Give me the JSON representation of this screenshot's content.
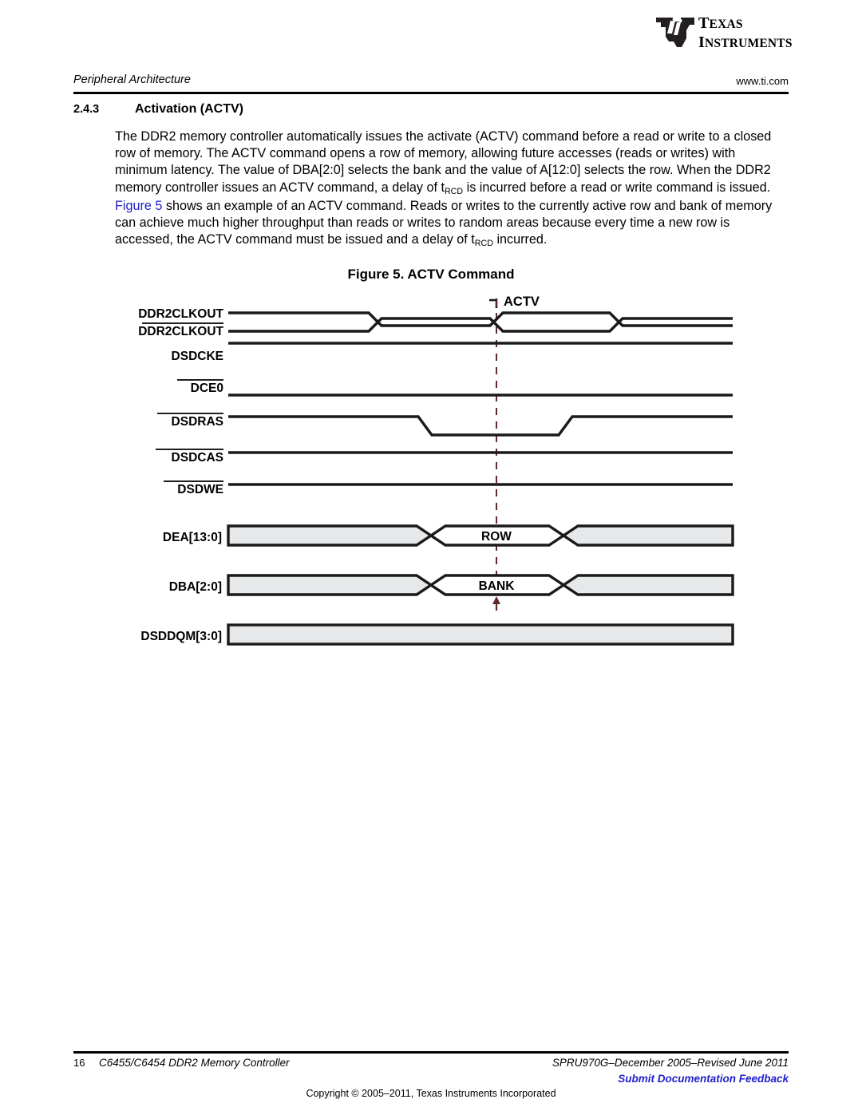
{
  "brand": {
    "logo_icon": "ti-logo-icon",
    "line1": "TEXAS",
    "line2": "INSTRUMENTS"
  },
  "header": {
    "title": "Peripheral Architecture",
    "url": "www.ti.com"
  },
  "section": {
    "number": "2.4.3",
    "title": "Activation (ACTV)"
  },
  "body": {
    "paragraph_part1": "The DDR2 memory controller automatically issues the activate (ACTV) command before a read or write to a closed row of memory. The ACTV command opens a row of memory, allowing future accesses (reads or writes) with minimum latency. The value of DBA[2:0] selects the bank and the value of A[12:0] selects the row. When the DDR2 memory controller issues an ACTV command, a delay of t",
    "sub1": "RCD",
    "paragraph_part2": " is incurred before a read or write command is issued. ",
    "link_text": "Figure 5",
    "paragraph_part3": " shows an example of an ACTV command. Reads or writes to the currently active row and bank of memory can achieve much higher throughput than reads or writes to random areas because every time a new row is accessed, the ACTV command must be issued and a delay of t",
    "sub2": "RCD",
    "paragraph_part4": " incurred."
  },
  "figure": {
    "caption": "Figure 5. ACTV Command",
    "marker_label": "ACTV",
    "signals": [
      {
        "name": "DDR2CLKOUT",
        "overbar": false,
        "type": "clock"
      },
      {
        "name": "DDR2CLKOUT",
        "overbar": true,
        "type": "clock"
      },
      {
        "name": "DSDCKE",
        "overbar": false,
        "type": "high"
      },
      {
        "name": "DCE0",
        "overbar": true,
        "type": "low"
      },
      {
        "name": "DSDRAS",
        "overbar": true,
        "type": "pulse-low"
      },
      {
        "name": "DSDCAS",
        "overbar": true,
        "type": "high"
      },
      {
        "name": "DSDWE",
        "overbar": true,
        "type": "high"
      },
      {
        "name": "DEA[13:0]",
        "overbar": false,
        "type": "bus",
        "value": "ROW"
      },
      {
        "name": "DBA[2:0]",
        "overbar": false,
        "type": "bus",
        "value": "BANK"
      },
      {
        "name": "DSDDQM[3:0]",
        "overbar": false,
        "type": "bus",
        "value": ""
      }
    ],
    "bus_values": {
      "row": "ROW",
      "bank": "BANK"
    },
    "colors": {
      "signal_line": "#1a1a1a",
      "bus_fill": "#e6e8ea",
      "marker_dash": "#5b2c2c"
    }
  },
  "footer": {
    "page_number": "16",
    "doc_title": "C6455/C6454 DDR2 Memory Controller",
    "doc_id": "SPRU970G–December 2005–Revised June 2011",
    "feedback": "Submit Documentation Feedback",
    "copyright": "Copyright © 2005–2011, Texas Instruments Incorporated"
  }
}
